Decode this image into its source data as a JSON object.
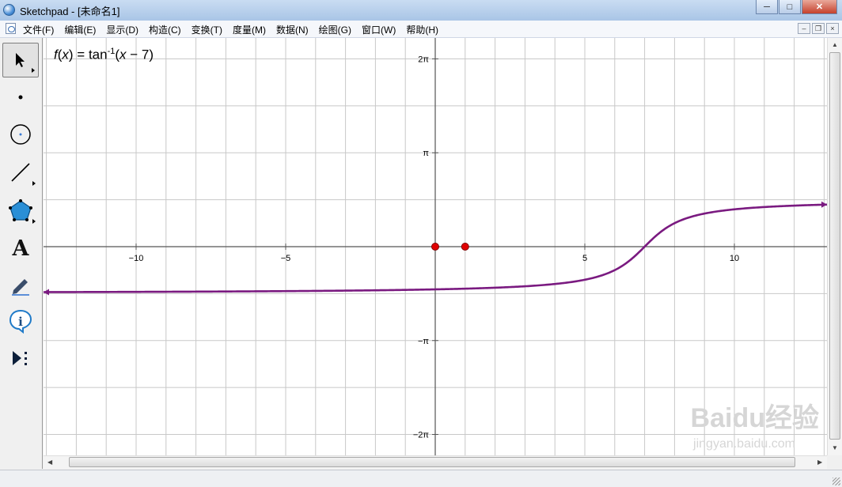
{
  "window": {
    "title": "Sketchpad  - [未命名1]",
    "controls": [
      "─",
      "□",
      "✕"
    ]
  },
  "menu": {
    "items": [
      "文件(F)",
      "编辑(E)",
      "显示(D)",
      "构造(C)",
      "变换(T)",
      "度量(M)",
      "数据(N)",
      "绘图(G)",
      "窗口(W)",
      "帮助(H)"
    ],
    "mdi_controls": [
      "–",
      "❐",
      "×"
    ]
  },
  "toolbox": {
    "tools": [
      "arrow-tool",
      "point-tool",
      "compass-tool",
      "straightedge-tool",
      "polygon-tool",
      "text-tool",
      "marker-tool",
      "information-tool",
      "custom-tool"
    ],
    "selected": "arrow-tool",
    "text_tool_glyph": "A"
  },
  "graph": {
    "function_label": {
      "f": "f",
      "var": "x",
      "eq": ") = tan",
      "sup": "-1",
      "arg_open": "(",
      "arg": "x",
      "arg_close": " − 7)"
    },
    "x_ticks": [
      {
        "value": -10,
        "label": "−10"
      },
      {
        "value": -5,
        "label": "−5"
      },
      {
        "value": 5,
        "label": "5"
      },
      {
        "value": 10,
        "label": "10"
      }
    ],
    "y_ticks": [
      {
        "value": 6.2832,
        "label": "2π"
      },
      {
        "value": 3.1416,
        "label": "π"
      },
      {
        "value": -3.1416,
        "label": "−π"
      },
      {
        "value": -6.2832,
        "label": "−2π"
      }
    ],
    "points": [
      {
        "x": 0,
        "y": 0
      },
      {
        "x": 1,
        "y": 0
      }
    ],
    "curve": {
      "function": "atan(x - 7)",
      "color": "#7a1a80"
    },
    "point_color": "#e00000"
  },
  "chart_data": {
    "type": "line",
    "title": "",
    "xlim": [
      -13,
      13.2
    ],
    "ylim": [
      -7,
      6.9
    ],
    "x_tick_values": [
      -10,
      -5,
      5,
      10
    ],
    "y_tick_labels": [
      "2π",
      "π",
      "−π",
      "−2π"
    ],
    "series": [
      {
        "x": [
          -13,
          -10,
          -5,
          -2,
          0,
          2,
          4,
          5,
          6,
          6.5,
          7,
          7.5,
          8,
          9,
          10,
          12,
          13.2
        ],
        "y": [
          -1.52,
          -1.52,
          -1.49,
          -1.46,
          -1.43,
          -1.37,
          -1.25,
          -1.11,
          -0.785,
          -0.46,
          0,
          0.46,
          0.785,
          1.11,
          1.25,
          1.37,
          1.41
        ]
      }
    ],
    "grid": true
  },
  "watermark": {
    "brand": "Baidu经验",
    "url": "jingyan.baidu.com"
  }
}
